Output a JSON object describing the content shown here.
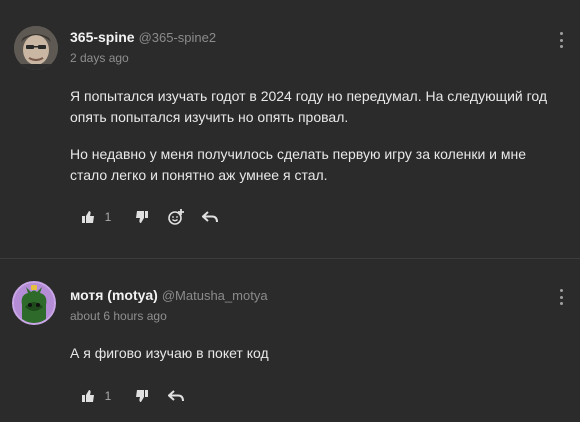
{
  "comments": [
    {
      "author": "365-spine",
      "handle": "@365-spine2",
      "time": "2 days ago",
      "paragraphs": [
        "Я попытался изучать годот в 2024 году но передумал. На следующий год опять попытался изучить но опять провал.",
        "Но недавно у меня получилось сделать первую игру за коленки и мне стало легко и понятно аж умнее я стал."
      ],
      "likes": "1"
    },
    {
      "author": "мотя (motya)",
      "handle": "@Matusha_motya",
      "time": "about 6 hours ago",
      "paragraphs": [
        "А я фигово изучаю в покет код"
      ],
      "likes": "1"
    }
  ],
  "icons": {
    "like": "thumbs-up-icon",
    "dislike": "thumbs-down-icon",
    "react": "emoji-add-icon",
    "reply": "reply-icon",
    "menu": "more-vertical-icon"
  },
  "colors": {
    "background": "#2b2b2b",
    "text": "#e8e8e8",
    "muted": "#8f8f8f",
    "divider": "#3d3d3d"
  }
}
